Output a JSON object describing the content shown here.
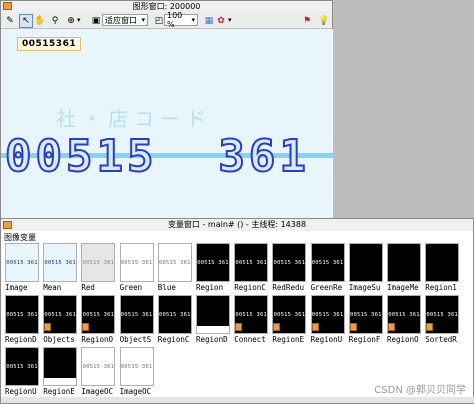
{
  "graphics_window": {
    "title": "图形窗口: 200000",
    "fit_dropdown": "适应窗口",
    "zoom_dropdown": "100 %",
    "overlay_label": "00515361",
    "background_text": "社・店コード",
    "big_digits": "00515  361"
  },
  "variable_window": {
    "title": "变量窗口 - main# () - 主线程: 14388",
    "section_label": "图像变量",
    "images": [
      {
        "caption": "Image",
        "style": "lightblue",
        "text": "00515 361",
        "badge": false
      },
      {
        "caption": "Mean",
        "style": "lightblue",
        "text": "00515 361",
        "badge": false
      },
      {
        "caption": "Red",
        "style": "gray",
        "text": "00515 361",
        "badge": false
      },
      {
        "caption": "Green",
        "style": "white",
        "text": "00515 361",
        "badge": false
      },
      {
        "caption": "Blue",
        "style": "white",
        "text": "00515 361",
        "badge": false
      },
      {
        "caption": "Region",
        "style": "black",
        "text": "00515 361",
        "badge": false
      },
      {
        "caption": "RegionC",
        "style": "black",
        "text": "00515 361",
        "badge": false
      },
      {
        "caption": "RedRedu",
        "style": "black",
        "text": "00515 361",
        "badge": false
      },
      {
        "caption": "GreenRe",
        "style": "black",
        "text": "00515 361",
        "badge": false
      },
      {
        "caption": "ImageSu",
        "style": "black",
        "text": "",
        "badge": false
      },
      {
        "caption": "ImageMe",
        "style": "black",
        "text": "",
        "badge": false
      },
      {
        "caption": "Region1",
        "style": "black",
        "text": "",
        "badge": false
      },
      {
        "caption": "RegionD",
        "style": "black",
        "text": "00515 361",
        "badge": false
      },
      {
        "caption": "Objects",
        "style": "colorful",
        "text": "00515 361",
        "badge": true
      },
      {
        "caption": "RegionO",
        "style": "black",
        "text": "00515 361",
        "badge": true
      },
      {
        "caption": "ObjectS",
        "style": "black",
        "text": "00515 361",
        "badge": false
      },
      {
        "caption": "RegionC",
        "style": "black",
        "text": "00515 361",
        "badge": false
      },
      {
        "caption": "RegionD",
        "style": "whitestripe",
        "text": "",
        "badge": false
      },
      {
        "caption": "Connect",
        "style": "black",
        "text": "00515 361",
        "badge": true
      },
      {
        "caption": "RegionE",
        "style": "black",
        "text": "00515 361",
        "badge": true
      },
      {
        "caption": "RegionU",
        "style": "black",
        "text": "00515 361",
        "badge": true
      },
      {
        "caption": "RegionF",
        "style": "black",
        "text": "00515 361",
        "badge": true
      },
      {
        "caption": "RegionO",
        "style": "black",
        "text": "00515 361",
        "badge": true
      },
      {
        "caption": "SortedR",
        "style": "black",
        "text": "00515 361",
        "badge": true
      },
      {
        "caption": "RegionU",
        "style": "black",
        "text": "00515 361",
        "badge": false
      },
      {
        "caption": "RegionE",
        "style": "whitestripe",
        "text": "",
        "badge": false
      },
      {
        "caption": "ImageOC",
        "style": "white",
        "text": "00515 361",
        "badge": false
      },
      {
        "caption": "ImageOC",
        "style": "white",
        "text": "00515 361",
        "badge": false
      }
    ]
  },
  "watermark": "CSDN @郭贝贝同学"
}
